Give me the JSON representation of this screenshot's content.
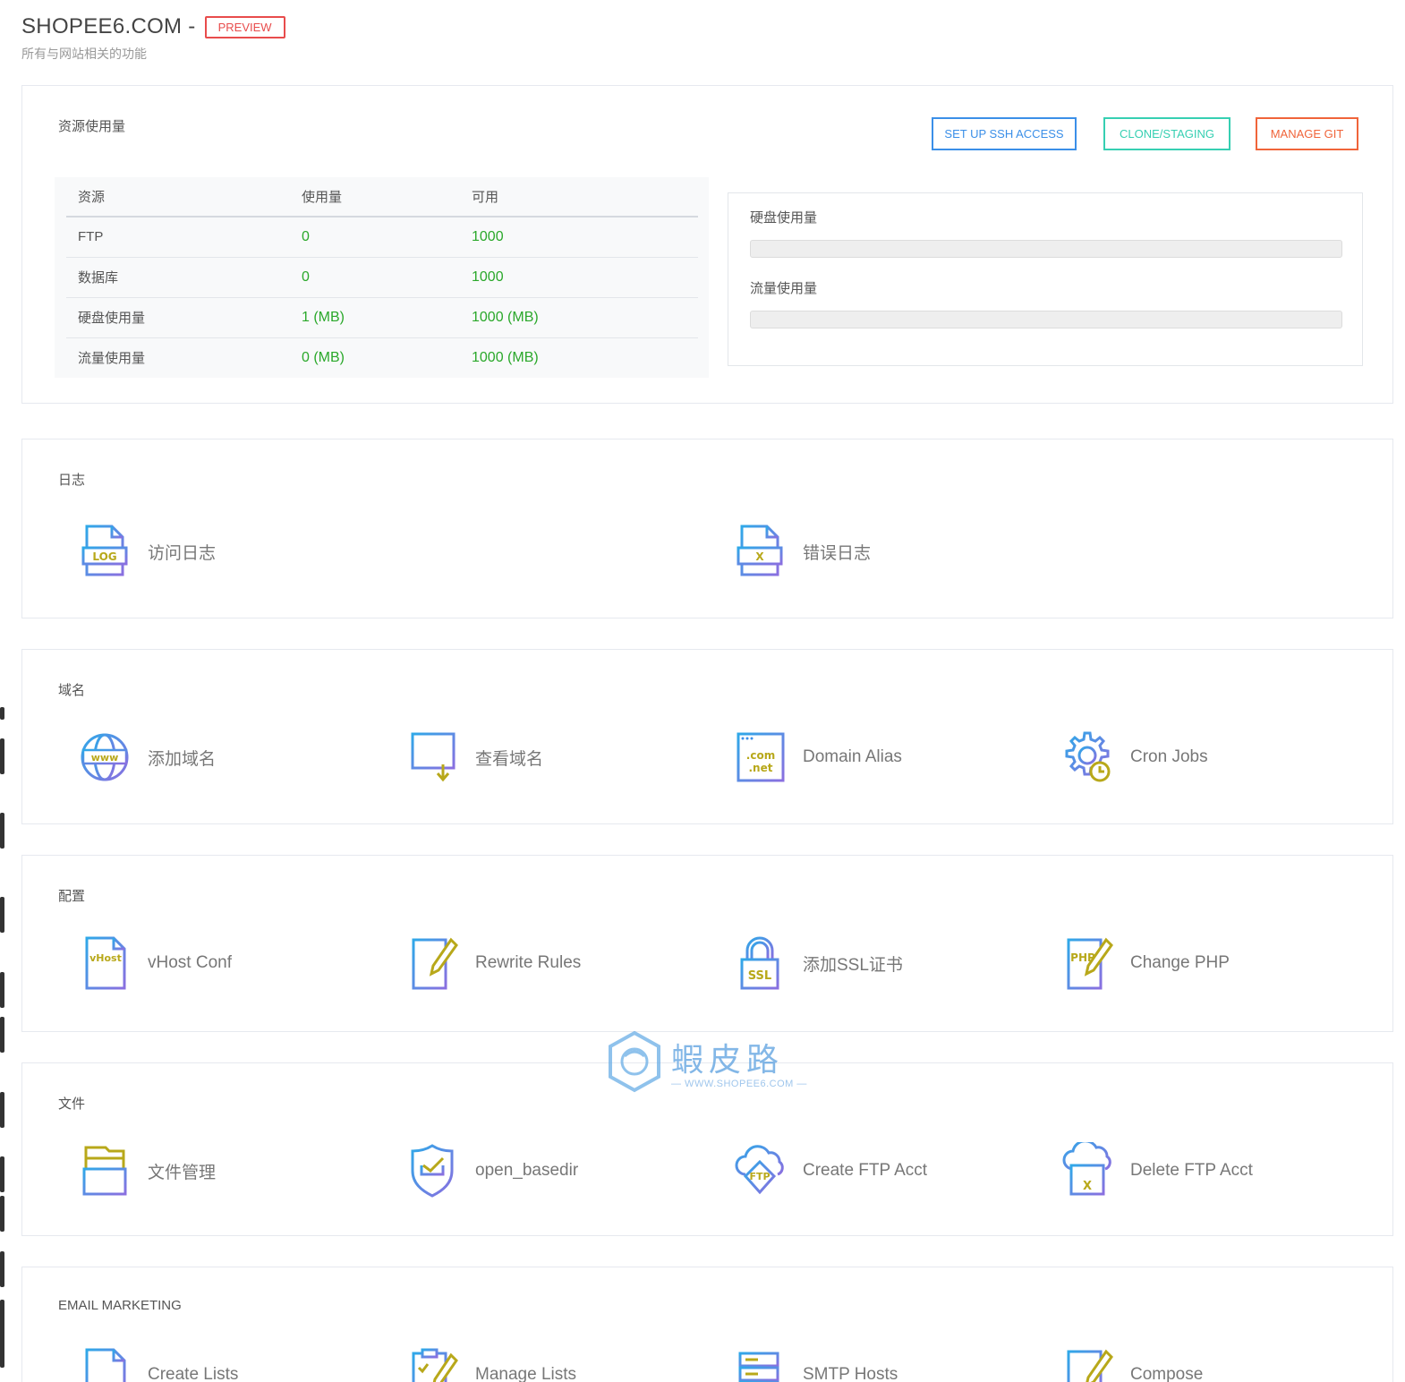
{
  "header": {
    "site_title": "SHOPEE6.COM -",
    "badge": "PREVIEW",
    "subtitle": "所有与网站相关的功能"
  },
  "resources": {
    "title": "资源使用量",
    "buttons": {
      "ssh": "SET UP SSH ACCESS",
      "clone": "CLONE/STAGING",
      "git": "MANAGE GIT"
    },
    "table": {
      "headers": [
        "资源",
        "使用量",
        "可用"
      ],
      "rows": [
        {
          "name": "FTP",
          "used": "0",
          "available": "1000"
        },
        {
          "name": "数据库",
          "used": "0",
          "available": "1000"
        },
        {
          "name": "硬盘使用量",
          "used": "1 (MB)",
          "available": "1000 (MB)"
        },
        {
          "name": "流量使用量",
          "used": "0 (MB)",
          "available": "1000 (MB)"
        }
      ]
    },
    "usage": {
      "disk_label": "硬盘使用量",
      "disk_percent": 0,
      "bandwidth_label": "流量使用量",
      "bandwidth_percent": 0
    }
  },
  "sections": {
    "logs": {
      "title": "日志",
      "items": [
        {
          "label": "访问日志",
          "icon": "log-file-icon"
        },
        {
          "label": "错误日志",
          "icon": "error-log-icon"
        }
      ]
    },
    "domains": {
      "title": "域名",
      "items": [
        {
          "label": "添加域名",
          "icon": "www-globe-icon"
        },
        {
          "label": "查看域名",
          "icon": "list-view-icon"
        },
        {
          "label": "Domain Alias",
          "icon": "com-net-icon"
        },
        {
          "label": "Cron Jobs",
          "icon": "gear-clock-icon"
        }
      ]
    },
    "config": {
      "title": "配置",
      "items": [
        {
          "label": "vHost Conf",
          "icon": "vhost-file-icon"
        },
        {
          "label": "Rewrite Rules",
          "icon": "edit-document-icon"
        },
        {
          "label": "添加SSL证书",
          "icon": "ssl-lock-icon"
        },
        {
          "label": "Change PHP",
          "icon": "php-edit-icon"
        }
      ]
    },
    "files": {
      "title": "文件",
      "items": [
        {
          "label": "文件管理",
          "icon": "file-cabinet-icon"
        },
        {
          "label": "open_basedir",
          "icon": "shield-check-icon"
        },
        {
          "label": "Create FTP Acct",
          "icon": "ftp-cloud-icon"
        },
        {
          "label": "Delete FTP Acct",
          "icon": "ftp-delete-icon"
        }
      ]
    },
    "email": {
      "title": "EMAIL MARKETING",
      "items": [
        {
          "label": "Create Lists",
          "icon": "create-list-icon"
        },
        {
          "label": "Manage Lists",
          "icon": "manage-list-icon"
        },
        {
          "label": "SMTP Hosts",
          "icon": "server-stack-icon"
        },
        {
          "label": "Compose",
          "icon": "compose-icon"
        }
      ]
    }
  },
  "watermark": {
    "cn": "蝦皮路",
    "url": "— WWW.SHOPEE6.COM —"
  },
  "colors": {
    "primary": "#3b8fe8",
    "teal": "#36cfb2",
    "orange": "#f0643a",
    "danger": "#e84c4c",
    "success": "#2aa82a",
    "icon_accent": "#b8a81a"
  }
}
